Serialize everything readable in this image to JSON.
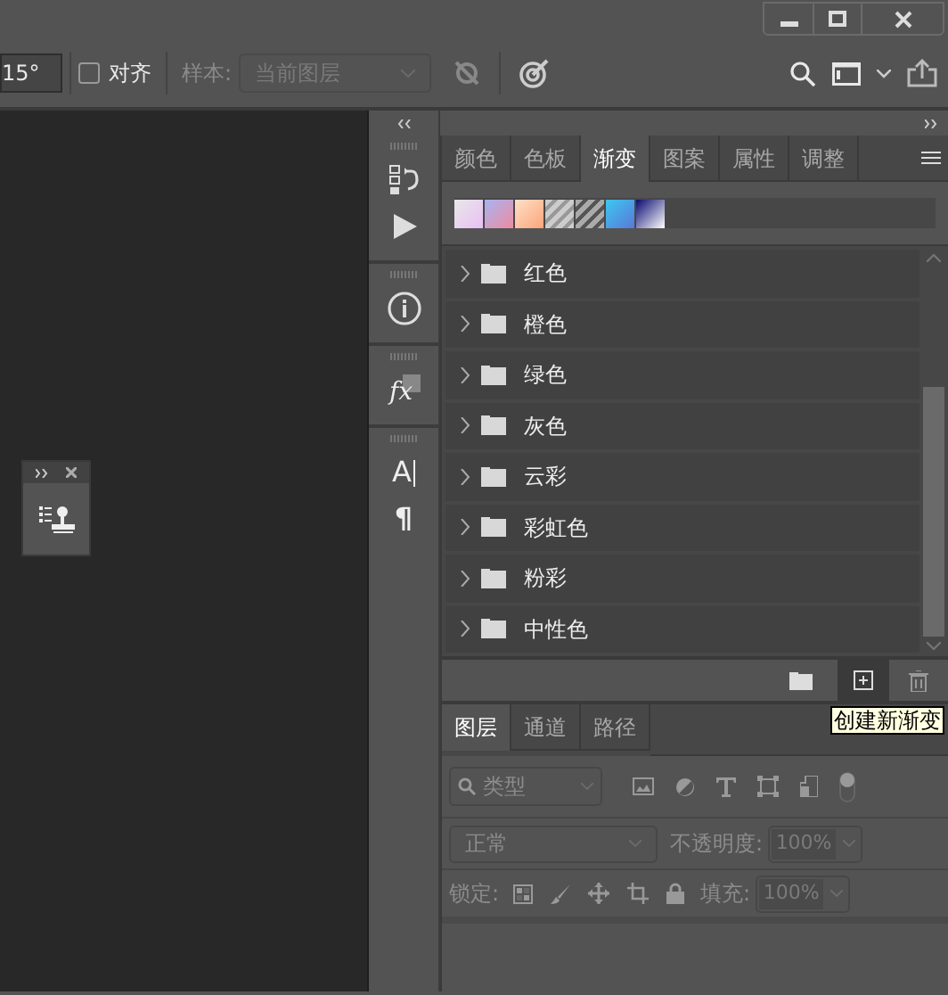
{
  "options_bar": {
    "angle_value": "15°",
    "align": {
      "label": "对齐",
      "checked": false
    },
    "sample_label": "样本:",
    "sample_value": "当前图层",
    "sample_disabled": true
  },
  "dock": {
    "groups": [
      [
        {
          "kind": "history"
        },
        {
          "kind": "play"
        }
      ],
      [
        {
          "kind": "info"
        }
      ],
      [
        {
          "kind": "styles",
          "glyph": "fx"
        }
      ],
      [
        {
          "kind": "character",
          "glyph": "A"
        },
        {
          "kind": "paragraph",
          "glyph": "¶"
        }
      ]
    ]
  },
  "gradients_panel": {
    "tabs": [
      {
        "label": "颜色",
        "selected": false
      },
      {
        "label": "色板",
        "selected": false
      },
      {
        "label": "渐变",
        "selected": true
      },
      {
        "label": "图案",
        "selected": false
      },
      {
        "label": "属性",
        "selected": false
      },
      {
        "label": "调整",
        "selected": false
      }
    ],
    "groups": [
      {
        "name": "红色",
        "expanded": false
      },
      {
        "name": "橙色",
        "expanded": false
      },
      {
        "name": "绿色",
        "expanded": false
      },
      {
        "name": "灰色",
        "expanded": false
      },
      {
        "name": "云彩",
        "expanded": false
      },
      {
        "name": "彩虹色",
        "expanded": false
      },
      {
        "name": "粉彩",
        "expanded": false
      },
      {
        "name": "中性色",
        "expanded": false
      }
    ],
    "tooltip": "创建新渐变"
  },
  "layers_panel": {
    "tabs": [
      {
        "label": "图层",
        "selected": true
      },
      {
        "label": "通道",
        "selected": false
      },
      {
        "label": "路径",
        "selected": false
      }
    ],
    "disabled": true,
    "filter_kind": "类型",
    "blend_mode": "正常",
    "opacity_label": "不透明度:",
    "opacity_value": "100%",
    "lock_label": "锁定:",
    "fill_label": "填充:",
    "fill_value": "100%"
  }
}
